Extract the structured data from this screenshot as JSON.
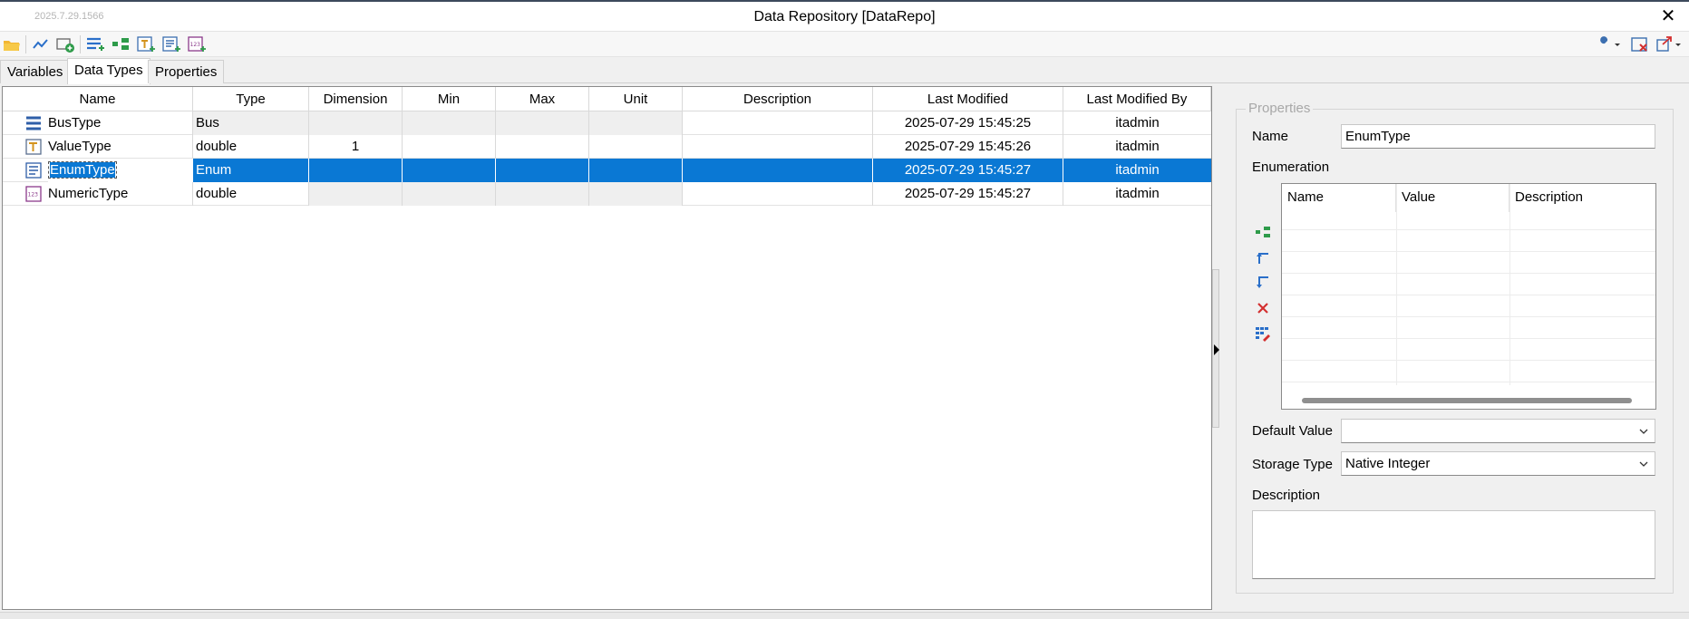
{
  "window": {
    "version": "2025.7.29.1566",
    "title": "Data Repository [DataRepo]",
    "close_glyph": "✕"
  },
  "tabs": [
    {
      "label": "Variables"
    },
    {
      "label": "Data Types"
    },
    {
      "label": "Properties"
    }
  ],
  "grid": {
    "columns": [
      "Name",
      "Type",
      "Dimension",
      "Min",
      "Max",
      "Unit",
      "Description",
      "Last Modified",
      "Last Modified By"
    ],
    "rows": [
      {
        "icon": "bus-type-icon",
        "name": "BusType",
        "type": "Bus",
        "dimension": "",
        "min": "",
        "max": "",
        "unit": "",
        "description": "",
        "last_modified": "2025-07-29 15:45:25",
        "last_modified_by": "itadmin"
      },
      {
        "icon": "value-type-icon",
        "name": "ValueType",
        "type": "double",
        "dimension": "1",
        "min": "",
        "max": "",
        "unit": "",
        "description": "",
        "last_modified": "2025-07-29 15:45:26",
        "last_modified_by": "itadmin"
      },
      {
        "icon": "enum-type-icon",
        "name": "EnumType",
        "type": "Enum",
        "dimension": "",
        "min": "",
        "max": "",
        "unit": "",
        "description": "",
        "last_modified": "2025-07-29 15:45:27",
        "last_modified_by": "itadmin"
      },
      {
        "icon": "numeric-type-icon",
        "name": "NumericType",
        "type": "double",
        "dimension": "",
        "min": "",
        "max": "",
        "unit": "",
        "description": "",
        "last_modified": "2025-07-29 15:45:27",
        "last_modified_by": "itadmin"
      }
    ]
  },
  "properties": {
    "legend": "Properties",
    "name_label": "Name",
    "name_value": "EnumType",
    "enumeration_label": "Enumeration",
    "enum_columns": [
      "Name",
      "Value",
      "Description"
    ],
    "default_value_label": "Default Value",
    "default_value": "",
    "storage_type_label": "Storage Type",
    "storage_type": "Native Integer",
    "description_label": "Description",
    "description_value": ""
  },
  "colors": {
    "selection": "#0a78d4",
    "accent_green": "#2e8b57",
    "accent_blue": "#2a6fc9",
    "delete_red": "#d32f2f"
  }
}
